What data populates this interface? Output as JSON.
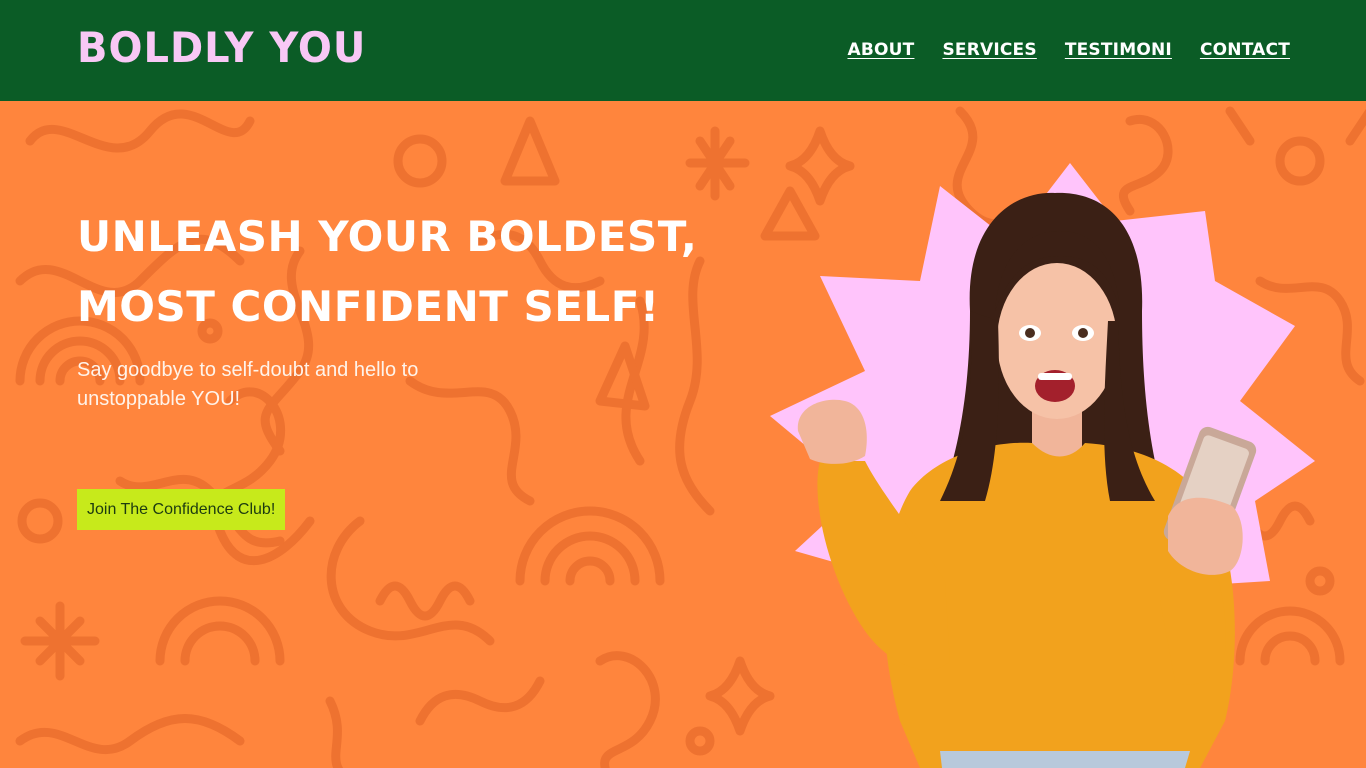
{
  "header": {
    "logo": "BOLDLY YOU",
    "nav": [
      "ABOUT",
      "SERVICES",
      "TESTIMONI",
      "CONTACT"
    ]
  },
  "hero": {
    "headline_line1": "UNLEASH YOUR BOLDEST,",
    "headline_line2": "MOST CONFIDENT SELF!",
    "subhead": "Say goodbye to self-doubt and hello to unstoppable YOU!",
    "cta_label": "Join The Confidence Club!"
  },
  "colors": {
    "header_bg": "#0b5c26",
    "logo": "#f8c8f5",
    "hero_bg": "#ff853d",
    "pattern": "#ee7230",
    "cta_bg": "#c7ea1b",
    "starburst": "#ffc4fb",
    "sweater": "#f2a21d"
  },
  "icons": {
    "hero_image": "excited-woman-with-phone-illustration",
    "starburst": "starburst-shape"
  }
}
